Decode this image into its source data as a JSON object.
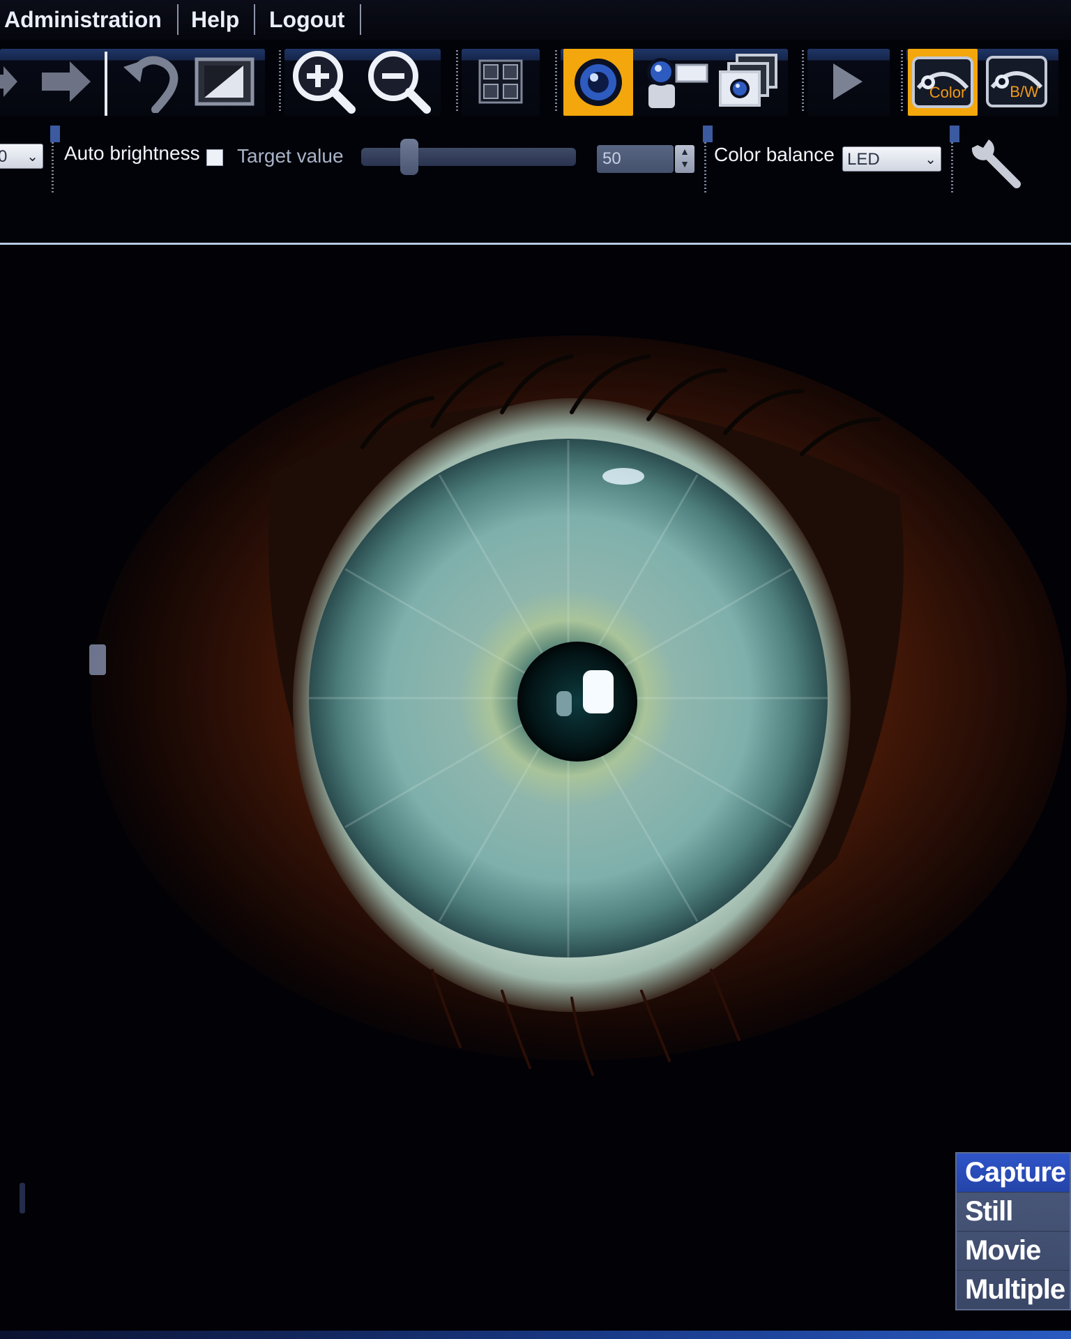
{
  "menu": {
    "items": [
      {
        "label": "Administration"
      },
      {
        "label": "Help"
      },
      {
        "label": "Logout"
      }
    ]
  },
  "toolbar": {
    "buttons": [
      {
        "icon": "back-arrow-icon",
        "state": "normal"
      },
      {
        "icon": "forward-arrow-icon",
        "state": "normal"
      },
      {
        "icon": "undo-icon",
        "state": "normal"
      },
      {
        "icon": "crop-frame-icon",
        "state": "normal"
      },
      {
        "icon": "zoom-in-icon",
        "state": "normal"
      },
      {
        "icon": "zoom-out-icon",
        "state": "normal"
      },
      {
        "icon": "grid-layout-icon",
        "state": "normal"
      },
      {
        "icon": "live-camera-icon",
        "state": "active"
      },
      {
        "icon": "camera-slide-icon",
        "state": "normal"
      },
      {
        "icon": "multi-capture-icon",
        "state": "normal"
      },
      {
        "icon": "play-icon",
        "state": "normal"
      },
      {
        "icon": "color-mode-icon",
        "label": "Color",
        "state": "active"
      },
      {
        "icon": "bw-mode-icon",
        "label": "B/W",
        "state": "normal"
      }
    ],
    "active_color": "#f3a70d"
  },
  "settings": {
    "left_select_value": "0",
    "auto_brightness_label": "Auto brightness",
    "auto_brightness_checked": false,
    "target_value_label": "Target value",
    "target_value_slider_fraction": 0.2,
    "target_value_input": "50",
    "color_balance_label": "Color balance",
    "color_balance_value": "LED",
    "settings_icon": "wrench-icon"
  },
  "viewport": {
    "content": "iris-image"
  },
  "capture_menu": {
    "header": "Capture",
    "items": [
      {
        "label": "Still"
      },
      {
        "label": "Movie"
      },
      {
        "label": "Multiple"
      }
    ]
  },
  "colors": {
    "rule": "#b7cbe3",
    "capture_header": "#2f55c9",
    "menu_text": "#e9eef8"
  }
}
